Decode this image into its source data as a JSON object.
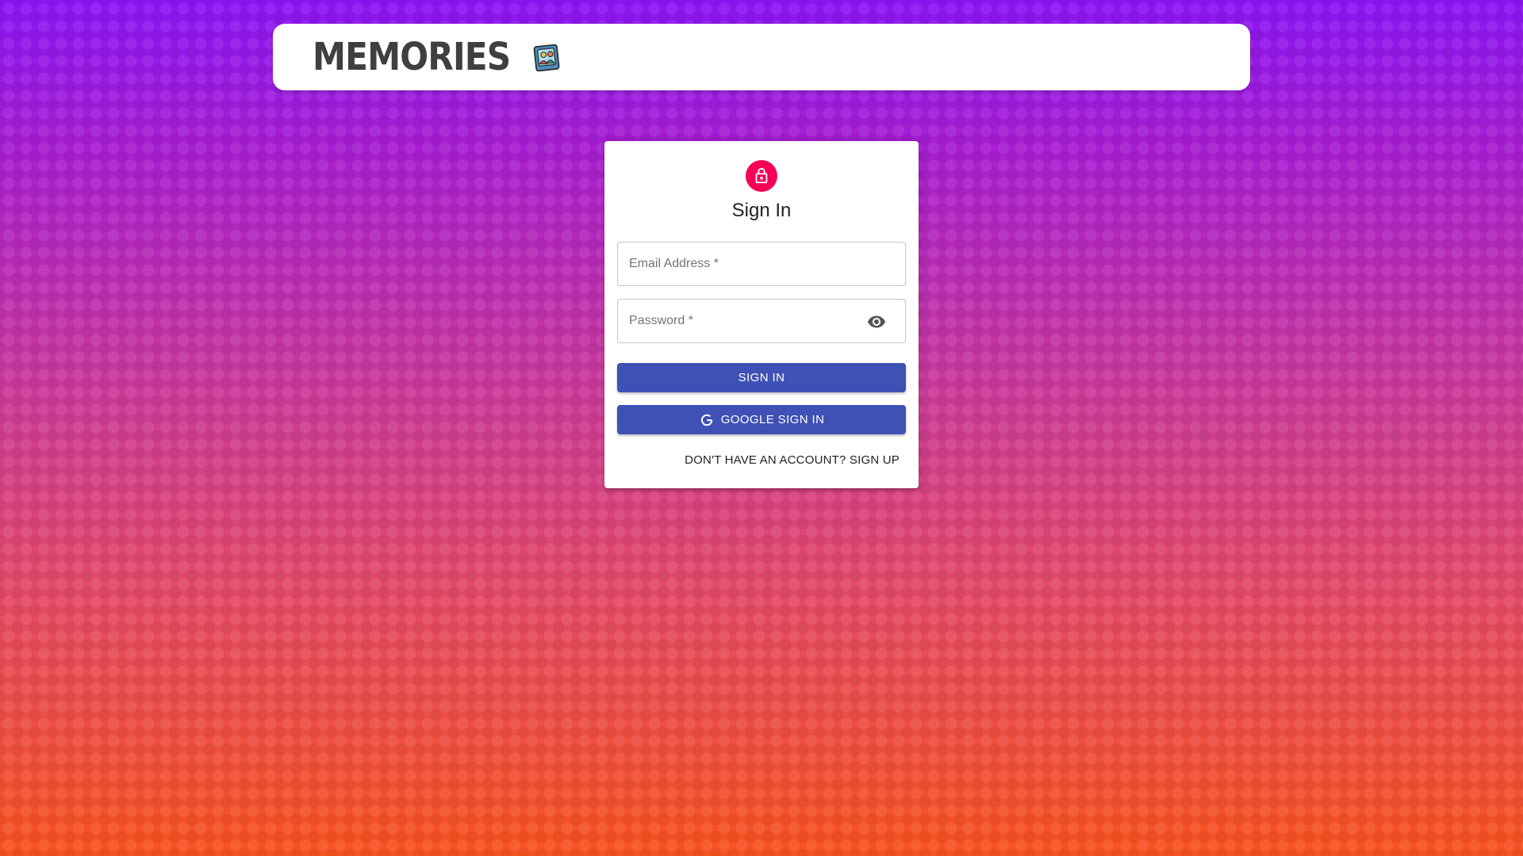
{
  "header": {
    "brand": "Memories",
    "brand_icon": "memories-photo-icon"
  },
  "signin": {
    "lock_icon": "lock-icon",
    "title": "Sign In",
    "email_placeholder": "Email Address *",
    "password_placeholder": "Password *",
    "eye_icon": "visibility-icon",
    "signin_button": "Sign In",
    "google_button": "Google Sign In",
    "google_icon": "google-icon",
    "signup_link": "Don't have an account? Sign Up"
  },
  "colors": {
    "accent": "#3f51b5",
    "avatar": "#f50057",
    "gradient_top": "#8a16f2",
    "gradient_bottom": "#f6531f"
  }
}
